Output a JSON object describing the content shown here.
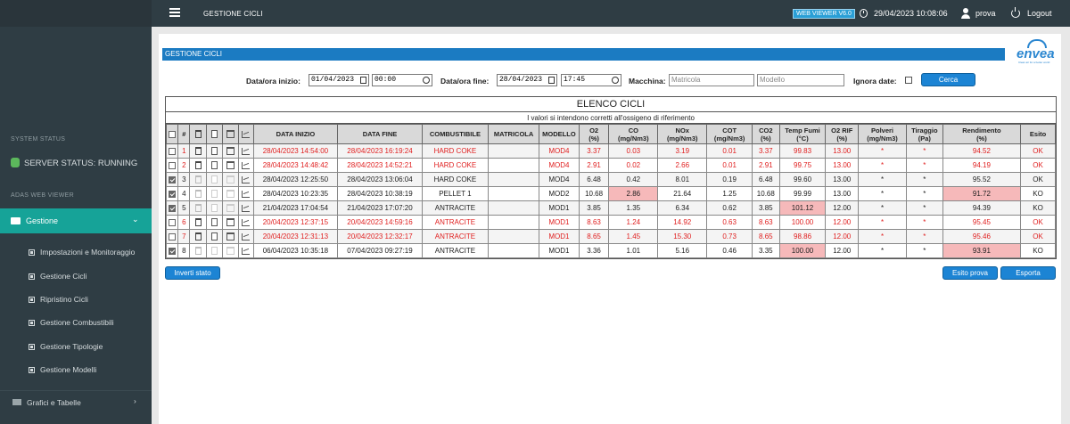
{
  "header": {
    "page_title": "GESTIONE CICLI",
    "version_badge": "WEB VIEWER V6.0",
    "datetime": "29/04/2023 10:08:06",
    "user": "prova",
    "logout_label": "Logout"
  },
  "sidebar": {
    "system_status_label": "SYSTEM STATUS",
    "server_status": "SERVER STATUS: RUNNING",
    "adas_label": "ADAS WEB VIEWER",
    "gestione_label": "Gestione",
    "sub_items": [
      "Impostazioni e Monitoraggio",
      "Gestione Cicli",
      "Ripristino Cicli",
      "Gestione Combustibili",
      "Gestione Tipologie",
      "Gestione Modelli"
    ],
    "grafici_label": "Grafici e Tabelle"
  },
  "panel": {
    "title": "GESTIONE CICLI",
    "logo_word": "envea",
    "logo_tagline": "Clean air for a better world"
  },
  "filters": {
    "start_label": "Data/ora inizio:",
    "start_date": "01/04/2023",
    "start_time": "00:00",
    "end_label": "Data/ora fine:",
    "end_date": "28/04/2023",
    "end_time": "17:45",
    "machine_label": "Macchina:",
    "matricola_placeholder": "Matricola",
    "modello_placeholder": "Modello",
    "ignora_label": "Ignora date:",
    "search_button": "Cerca"
  },
  "table": {
    "title": "ELENCO CICLI",
    "note": "I valori si intendono corretti all'ossigeno di riferimento",
    "headers": {
      "num": "#",
      "start": "DATA INIZIO",
      "end": "DATA FINE",
      "fuel": "COMBUSTIBILE",
      "matricola": "MATRICOLA",
      "model": "MODELLO",
      "o2": "O2",
      "o2_unit": "(%)",
      "co": "CO",
      "co_unit": "(mg/Nm3)",
      "nox": "NOx",
      "nox_unit": "(mg/Nm3)",
      "cot": "COT",
      "cot_unit": "(mg/Nm3)",
      "co2": "CO2",
      "co2_unit": "(%)",
      "temp": "Temp Fumi",
      "temp_unit": "(°C)",
      "o2rif": "O2 RIF",
      "o2rif_unit": "(%)",
      "polveri": "Polveri",
      "polveri_unit": "(mg/Nm3)",
      "tiraggio": "Tiraggio",
      "tiraggio_unit": "(Pa)",
      "rendimento": "Rendimento",
      "rendimento_unit": "(%)",
      "esito": "Esito"
    },
    "rows": [
      {
        "checked": false,
        "num": "1",
        "start": "28/04/2023 14:54:00",
        "end": "28/04/2023 16:19:24",
        "fuel": "HARD COKE",
        "matricola": "",
        "model": "MOD4",
        "o2": "3.37",
        "co": "0.03",
        "nox": "3.19",
        "cot": "0.01",
        "co2": "3.37",
        "temp": "99.83",
        "o2rif": "13.00",
        "polveri": "*",
        "tiraggio": "*",
        "rendimento": "94.52",
        "esito": "OK",
        "red": true,
        "hl": []
      },
      {
        "checked": false,
        "num": "2",
        "start": "28/04/2023 14:48:42",
        "end": "28/04/2023 14:52:21",
        "fuel": "HARD COKE",
        "matricola": "",
        "model": "MOD4",
        "o2": "2.91",
        "co": "0.02",
        "nox": "2.66",
        "cot": "0.01",
        "co2": "2.91",
        "temp": "99.75",
        "o2rif": "13.00",
        "polveri": "*",
        "tiraggio": "*",
        "rendimento": "94.19",
        "esito": "OK",
        "red": true,
        "hl": []
      },
      {
        "checked": true,
        "num": "3",
        "start": "28/04/2023 12:25:50",
        "end": "28/04/2023 13:06:04",
        "fuel": "HARD COKE",
        "matricola": "",
        "model": "MOD4",
        "o2": "6.48",
        "co": "0.42",
        "nox": "8.01",
        "cot": "0.19",
        "co2": "6.48",
        "temp": "99.60",
        "o2rif": "13.00",
        "polveri": "*",
        "tiraggio": "*",
        "rendimento": "95.52",
        "esito": "OK",
        "red": false,
        "hl": []
      },
      {
        "checked": true,
        "num": "4",
        "start": "28/04/2023 10:23:35",
        "end": "28/04/2023 10:38:19",
        "fuel": "PELLET 1",
        "matricola": "",
        "model": "MOD2",
        "o2": "10.68",
        "co": "2.86",
        "nox": "21.64",
        "cot": "1.25",
        "co2": "10.68",
        "temp": "99.99",
        "o2rif": "13.00",
        "polveri": "*",
        "tiraggio": "*",
        "rendimento": "91.72",
        "esito": "KO",
        "red": false,
        "hl": [
          "co",
          "rendimento"
        ]
      },
      {
        "checked": true,
        "num": "5",
        "start": "21/04/2023 17:04:54",
        "end": "21/04/2023 17:07:20",
        "fuel": "ANTRACITE",
        "matricola": "",
        "model": "MOD1",
        "o2": "3.85",
        "co": "1.35",
        "nox": "6.34",
        "cot": "0.62",
        "co2": "3.85",
        "temp": "101.12",
        "o2rif": "12.00",
        "polveri": "*",
        "tiraggio": "*",
        "rendimento": "94.39",
        "esito": "KO",
        "red": false,
        "hl": [
          "temp"
        ]
      },
      {
        "checked": false,
        "num": "6",
        "start": "20/04/2023 12:37:15",
        "end": "20/04/2023 14:59:16",
        "fuel": "ANTRACITE",
        "matricola": "",
        "model": "MOD1",
        "o2": "8.63",
        "co": "1.24",
        "nox": "14.92",
        "cot": "0.63",
        "co2": "8.63",
        "temp": "100.00",
        "o2rif": "12.00",
        "polveri": "*",
        "tiraggio": "*",
        "rendimento": "95.45",
        "esito": "OK",
        "red": true,
        "hl": []
      },
      {
        "checked": false,
        "num": "7",
        "start": "20/04/2023 12:31:13",
        "end": "20/04/2023 12:32:17",
        "fuel": "ANTRACITE",
        "matricola": "",
        "model": "MOD1",
        "o2": "8.65",
        "co": "1.45",
        "nox": "15.30",
        "cot": "0.73",
        "co2": "8.65",
        "temp": "98.86",
        "o2rif": "12.00",
        "polveri": "*",
        "tiraggio": "*",
        "rendimento": "95.46",
        "esito": "OK",
        "red": true,
        "hl": []
      },
      {
        "checked": true,
        "num": "8",
        "start": "06/04/2023 10:35:18",
        "end": "07/04/2023 09:27:19",
        "fuel": "ANTRACITE",
        "matricola": "",
        "model": "MOD1",
        "o2": "3.36",
        "co": "1.01",
        "nox": "5.16",
        "cot": "0.46",
        "co2": "3.35",
        "temp": "100.00",
        "o2rif": "12.00",
        "polveri": "*",
        "tiraggio": "*",
        "rendimento": "93.91",
        "esito": "KO",
        "red": false,
        "hl": [
          "temp",
          "rendimento"
        ]
      }
    ]
  },
  "actions": {
    "invert": "Inverti stato",
    "esito_prova": "Esito prova",
    "esporta": "Esporta"
  },
  "colors": {
    "accent": "#16a398",
    "title_bar": "#1b7bc2",
    "highlight": "#f6b9ba",
    "red_text": "#e02020"
  }
}
